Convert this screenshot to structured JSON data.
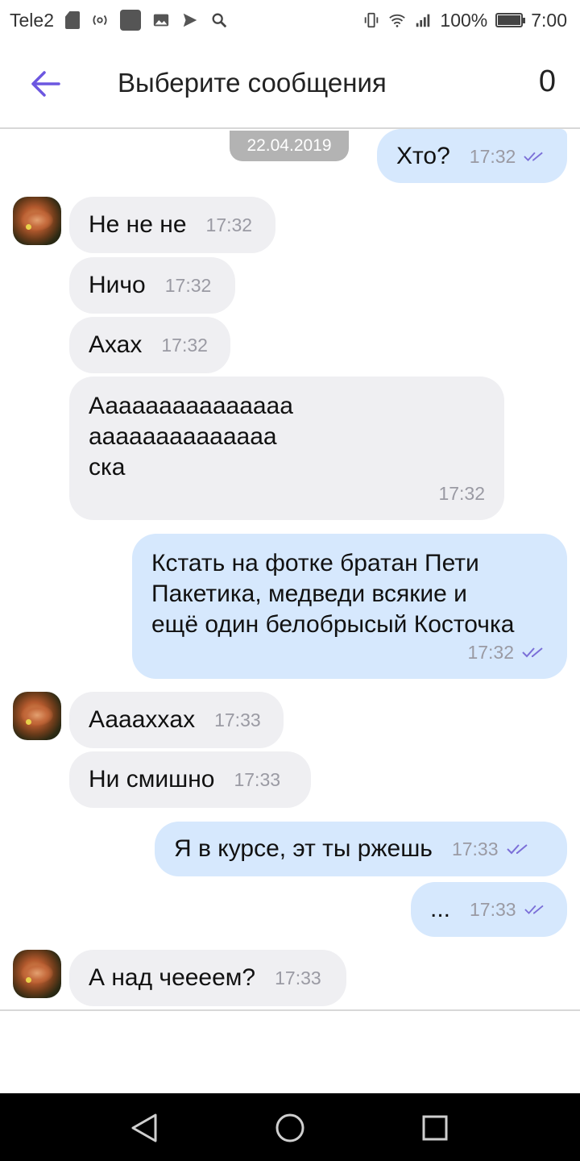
{
  "status_bar": {
    "carrier": "Tele2",
    "battery": "100%",
    "time": "7:00"
  },
  "header": {
    "title": "Выберите сообщения",
    "selected_count": "0"
  },
  "chat": {
    "date_label": "22.04.2019",
    "messages": [
      {
        "direction": "out",
        "text": "Хто?",
        "time": "17:32",
        "read": true
      },
      {
        "direction": "in",
        "text": "Не не не",
        "time": "17:32"
      },
      {
        "direction": "in",
        "text": "Ничо",
        "time": "17:32"
      },
      {
        "direction": "in",
        "text": "Ахах",
        "time": "17:32"
      },
      {
        "direction": "in",
        "text": "Ааааааааааааааа\nаааааааааааааа\nска",
        "time": "17:32"
      },
      {
        "direction": "out",
        "text": "Кстать на фотке братан Пети\nПакетика, медведи всякие и\nещё один белобрысый Косточка",
        "time": "17:32",
        "read": true
      },
      {
        "direction": "in",
        "text": "Аааахxах",
        "time": "17:33"
      },
      {
        "direction": "in",
        "text": "Ни смишно",
        "time": "17:33"
      },
      {
        "direction": "out",
        "text": "Я в курсе, эт ты ржешь",
        "time": "17:33",
        "read": true
      },
      {
        "direction": "out",
        "text": "...",
        "time": "17:33",
        "read": true
      },
      {
        "direction": "in",
        "text": "А над чееeем?",
        "time": "17:33"
      }
    ]
  },
  "colors": {
    "accent": "#6c57e0",
    "incoming_bubble": "#efeff2",
    "outgoing_bubble": "#d6e8fd",
    "time_text": "#9a9aa3",
    "read_ticks": "#7b6fd8"
  },
  "icons": {
    "back": "arrow-left-icon",
    "read_status": "double-check-icon",
    "nav_back": "triangle-back-icon",
    "nav_home": "circle-home-icon",
    "nav_recents": "square-recents-icon"
  }
}
